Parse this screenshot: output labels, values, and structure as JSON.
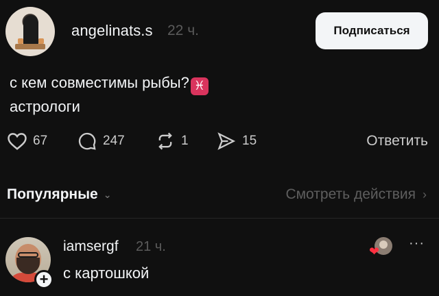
{
  "post": {
    "author": "angelinats.s",
    "time": "22 ч.",
    "subscribe_label": "Подписаться",
    "text_line1": "с кем совместимы рыбы?",
    "emoji": "♓",
    "text_line2": "астрологи",
    "likes": "67",
    "replies": "247",
    "reposts": "1",
    "shares": "15",
    "answer_label": "Ответить"
  },
  "filter": {
    "sort_label": "Популярные",
    "view_activity": "Смотреть действия"
  },
  "reply": {
    "author": "iamsergf",
    "time": "21 ч.",
    "text": "с картошкой",
    "follow_symbol": "+",
    "more_symbol": "···"
  },
  "icons": {
    "like": "heart-icon",
    "reply": "comment-icon",
    "repost": "repost-icon",
    "share": "send-icon",
    "chevron": "chevron-icon"
  },
  "colors": {
    "background": "#101010",
    "text": "#f3f5f7",
    "muted": "#5b5b5b",
    "liked": "#ff3040",
    "pisces": "#d9345d"
  }
}
